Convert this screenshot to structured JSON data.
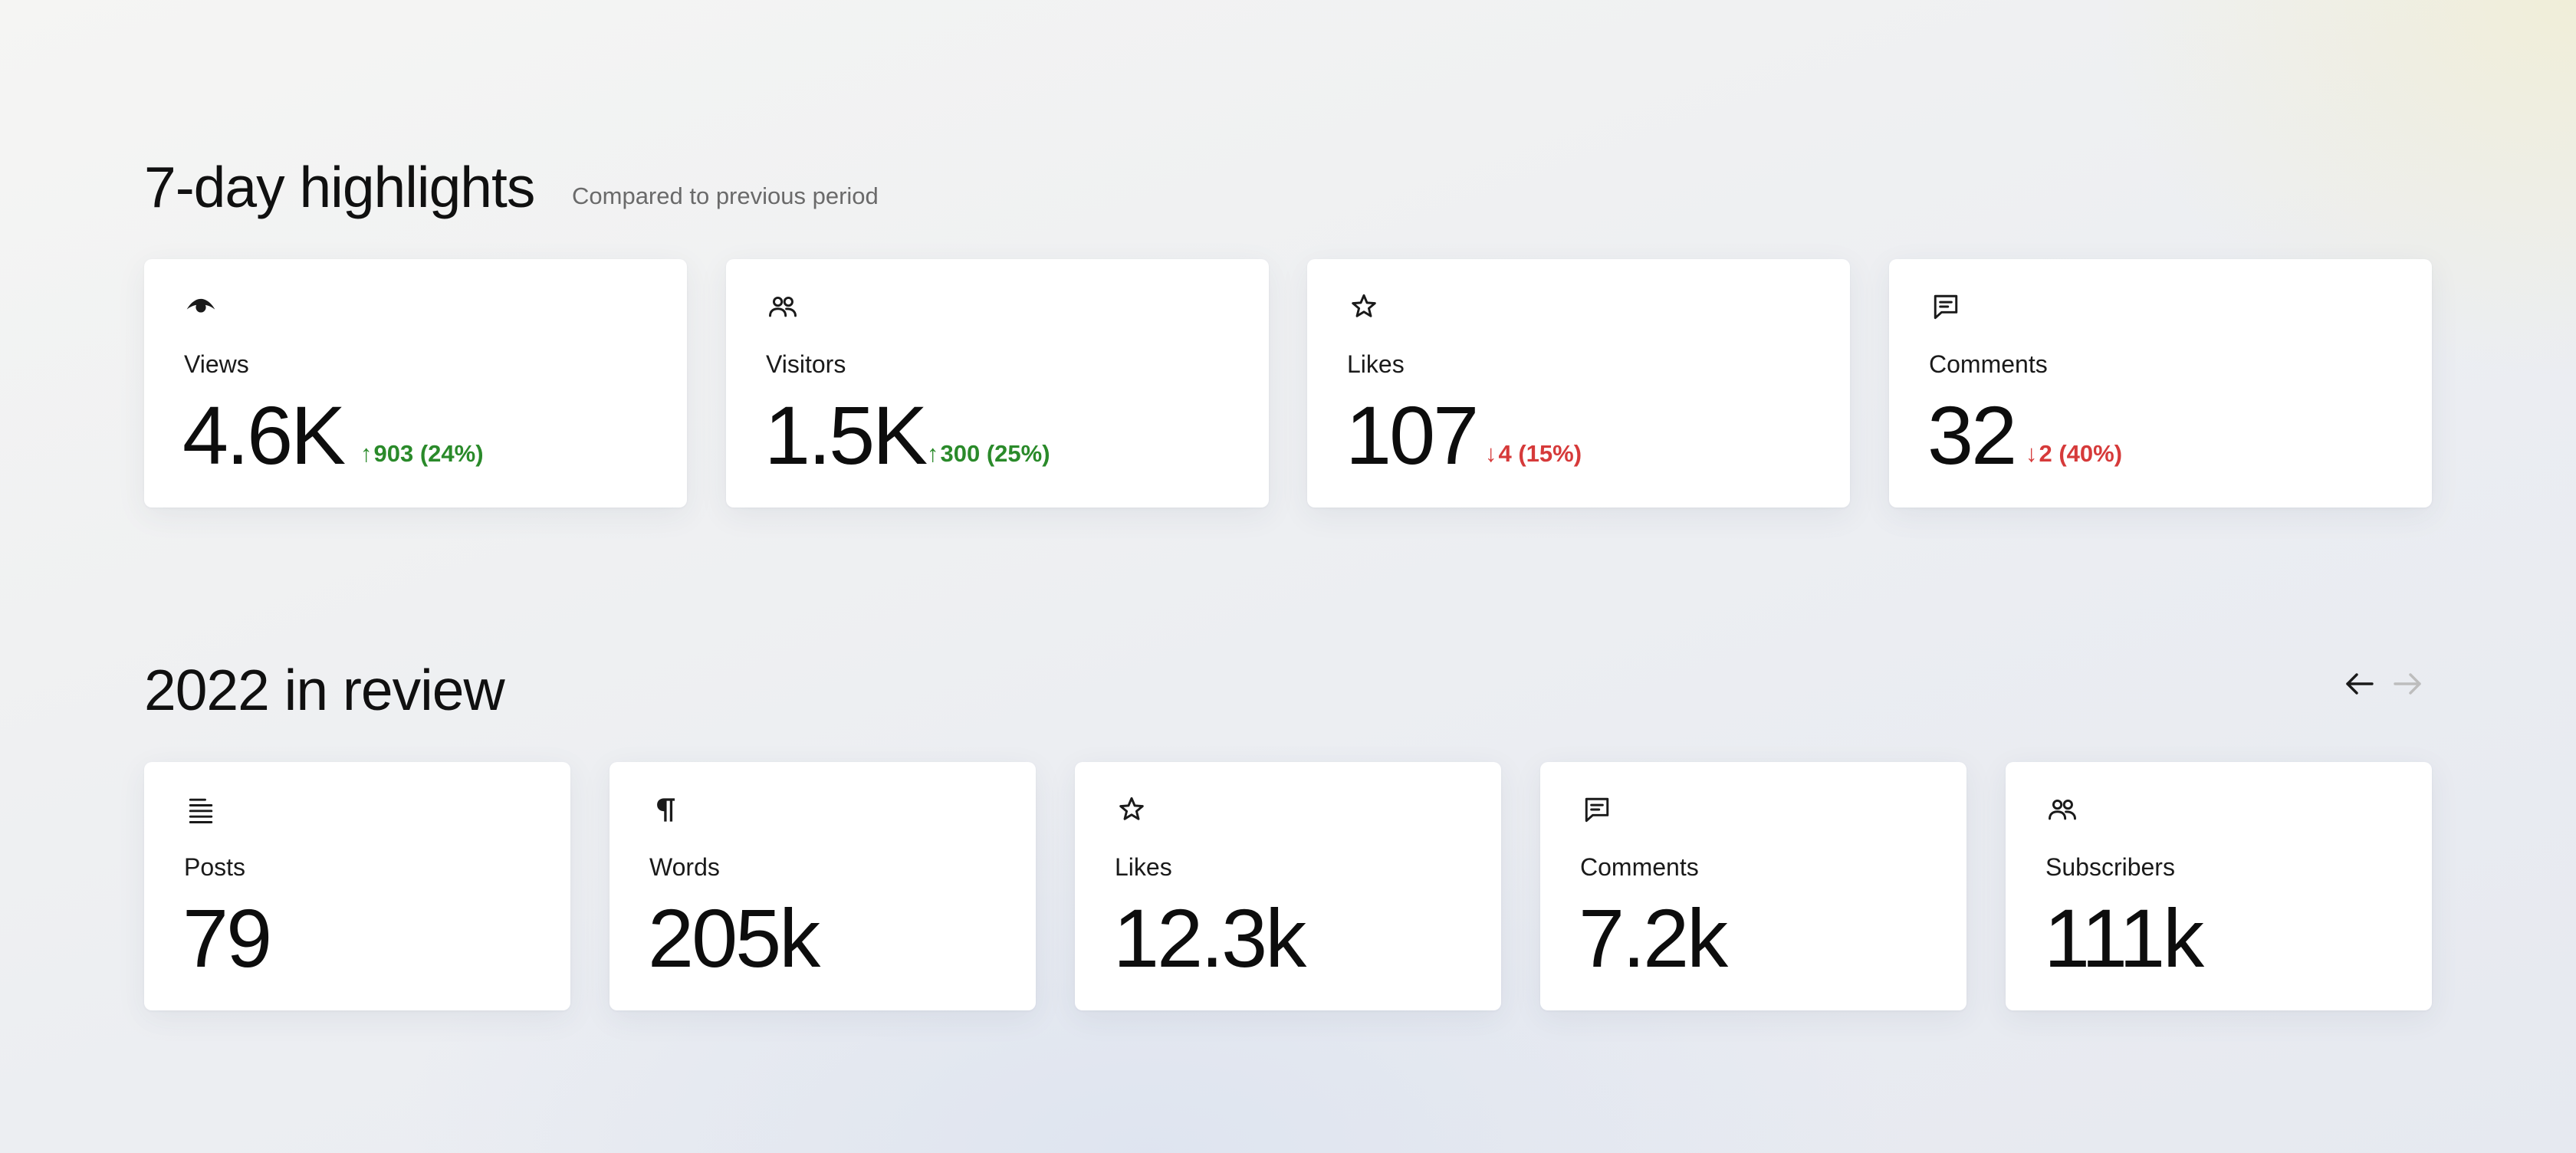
{
  "highlights": {
    "title": "7-day highlights",
    "subtitle": "Compared to previous period",
    "cards": [
      {
        "icon": "eye-icon",
        "label": "Views",
        "value": "4.6K",
        "delta_direction": "up",
        "delta": "903 (24%)"
      },
      {
        "icon": "people-icon",
        "label": "Visitors",
        "value": "1.5K",
        "delta_direction": "up",
        "delta": "300 (25%)"
      },
      {
        "icon": "star-icon",
        "label": "Likes",
        "value": "107",
        "delta_direction": "down",
        "delta": "4 (15%)"
      },
      {
        "icon": "comment-icon",
        "label": "Comments",
        "value": "32",
        "delta_direction": "down",
        "delta": "2 (40%)"
      }
    ]
  },
  "review": {
    "title": "2022 in review",
    "nav": {
      "prev_icon": "arrow-left-icon",
      "next_icon": "arrow-right-icon",
      "next_disabled": true
    },
    "cards": [
      {
        "icon": "lines-icon",
        "label": "Posts",
        "value": "79"
      },
      {
        "icon": "pilcrow-icon",
        "label": "Words",
        "value": "205k"
      },
      {
        "icon": "star-icon",
        "label": "Likes",
        "value": "12.3k"
      },
      {
        "icon": "comment-icon",
        "label": "Comments",
        "value": "7.2k"
      },
      {
        "icon": "people-icon",
        "label": "Subscribers",
        "value": "111k"
      }
    ]
  },
  "colors": {
    "positive": "#2a8a2a",
    "negative": "#d63a3a",
    "nav_disabled": "#bdbdbd"
  }
}
